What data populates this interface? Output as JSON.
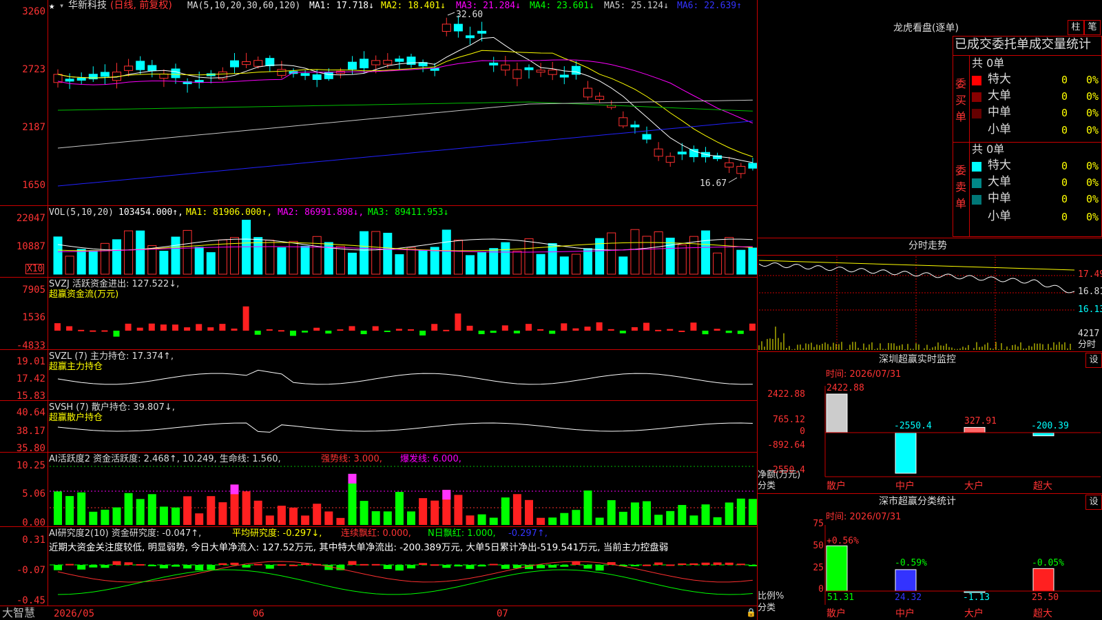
{
  "app": {
    "brand": "大智慧"
  },
  "kline": {
    "stock": "华新科技",
    "period": "(日线, 前复权)",
    "ma_label": "MA(5,10,20,30,60,120)",
    "ma": [
      {
        "t": "MA1: 17.718↓",
        "c": "#ffffff"
      },
      {
        "t": "MA2: 18.401↓",
        "c": "#ffff00"
      },
      {
        "t": "MA3: 21.284↓",
        "c": "#ff00ff"
      },
      {
        "t": "MA4: 23.601↓",
        "c": "#00ff00"
      },
      {
        "t": "MA5: 25.124↓",
        "c": "#cccccc"
      },
      {
        "t": "MA6: 22.639↑",
        "c": "#3333ff"
      }
    ],
    "y_labels": [
      "3260",
      "2723",
      "2187",
      "1650"
    ],
    "high_mark": "32.60",
    "low_mark": "16.67"
  },
  "vol": {
    "label": "VOL(5,10,20)",
    "value": "103454.000↑,",
    "ma1": "MA1: 81906.000↑,",
    "ma2": "MA2: 86991.898↓,",
    "ma3": "MA3: 89411.953↓",
    "y_labels": [
      "22047",
      "10887"
    ],
    "unit": "X10"
  },
  "svzj": {
    "label": "SVZJ 活跃资金进出: 127.522↓,",
    "sub": "超赢资金流(万元)",
    "y_labels": [
      "7905",
      "1536",
      "-4833"
    ]
  },
  "svzl": {
    "label": "SVZL (7) 主力持仓: 17.374↑,",
    "sub": "超赢主力持仓",
    "y_labels": [
      "19.01",
      "17.42",
      "15.83"
    ]
  },
  "svsh": {
    "label": "SVSH (7) 散户持仓: 39.807↓,",
    "sub": "超赢散户持仓",
    "y_labels": [
      "40.64",
      "38.17",
      "35.80"
    ]
  },
  "ai_act": {
    "label": "AI活跃度2 资金活跃度: 2.468↑, 10.249, 生命线: 1.560,",
    "strong": "强势线: 3.000,",
    "burst": "爆发线: 6.000,",
    "y_labels": [
      "10.25",
      "5.06",
      "0.00"
    ]
  },
  "ai_res": {
    "label": "AI研究度2(10) 资金研究度: -0.047↑,",
    "avg": "平均研究度: -0.297↓,",
    "lian": "连续飘红: 0.000,",
    "nday": "N日飘红: 1.000,",
    "last": "-0.297↑,",
    "note": "近期大资金关注度较低, 明显弱势, 今日大单净流入: 127.52万元, 其中特大单净流出: -200.389万元, 大单5日累计净出-519.541万元, 当前主力控盘弱",
    "y_labels": [
      "0.31",
      "-0.07",
      "-0.45"
    ]
  },
  "xaxis": [
    "2026/05",
    "06",
    "07"
  ],
  "longhu": {
    "title": "龙虎看盘(逐单)",
    "btn1": "柱",
    "btn2": "笔",
    "subtitle": "已成交委托单成交量统计",
    "buy_label": "委买单",
    "sell_label": "委卖单",
    "total": "共 0单",
    "rows": [
      "特大",
      "大单",
      "中单",
      "小单"
    ],
    "zero": "0",
    "pct": "0%",
    "buy_colors": [
      "#ff0000",
      "#880000",
      "#660000",
      "#000000"
    ],
    "sell_colors": [
      "#00ffff",
      "#008888",
      "#007777",
      "#000000"
    ]
  },
  "fenshi": {
    "title": "分时走势",
    "y_labels": [
      "17.49",
      "16.81",
      "16.13"
    ],
    "vol_label": "4217",
    "vol_unit": "分时"
  },
  "monitor": {
    "title": "深圳超赢实时监控",
    "btn": "设",
    "time": "时间: 2026/07/31",
    "y_labels": [
      "2422.88",
      "765.12",
      "0",
      "-892.64",
      "-2550.4"
    ],
    "ylabel": "净额(万元)",
    "cat_label": "分类",
    "bars": [
      {
        "name": "散户",
        "value": 2422.88,
        "label": "2422.88"
      },
      {
        "name": "中户",
        "value": -2550.4,
        "label": "-2550.4"
      },
      {
        "name": "大户",
        "value": 327.91,
        "label": "327.91"
      },
      {
        "name": "超大",
        "value": -200.39,
        "label": "-200.39"
      }
    ]
  },
  "classify": {
    "title": "深市超赢分类统计",
    "btn": "设",
    "time": "时间: 2026/07/31",
    "y_labels": [
      "75",
      "50",
      "25",
      "0"
    ],
    "ylabel": "比例%",
    "cat_label": "分类",
    "bars": [
      {
        "name": "散户",
        "value": 51.31,
        "top": "+0.56%",
        "bottom": "51.31"
      },
      {
        "name": "中户",
        "value": 24.32,
        "top": "-0.59%",
        "bottom": "24.32"
      },
      {
        "name": "大户",
        "value": -1.13,
        "top": "",
        "bottom": "-1.13"
      },
      {
        "name": "超大",
        "value": 25.5,
        "top": "-0.05%",
        "bottom": "25.50"
      }
    ]
  }
}
